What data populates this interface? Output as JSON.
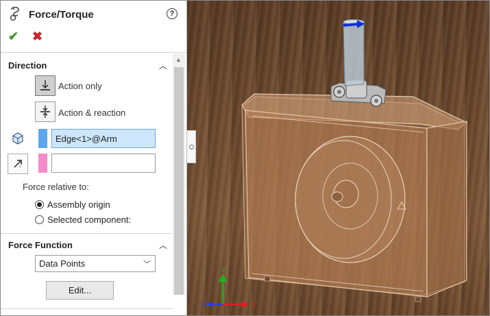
{
  "panel": {
    "title": "Force/Torque",
    "help_icon": "question-circle-icon",
    "ok_icon": "checkmark-icon",
    "cancel_icon": "x-icon"
  },
  "direction": {
    "section_title": "Direction",
    "action_only": "Action only",
    "action_reaction": "Action & reaction",
    "field1_value": "Edge<1>@Arm",
    "field1_color": "#5aa7ee",
    "field2_value": "",
    "field2_color": "#f58bc8",
    "relative_label": "Force relative to:",
    "options": [
      "Assembly origin",
      "Selected component:"
    ],
    "selected_option": "Assembly origin"
  },
  "force_function": {
    "section_title": "Force Function",
    "selected": "Data Points",
    "edit_label": "Edit..."
  },
  "axes": {
    "x_color": "#e02020",
    "y_color": "#20b020",
    "z_color": "#2040e0"
  }
}
